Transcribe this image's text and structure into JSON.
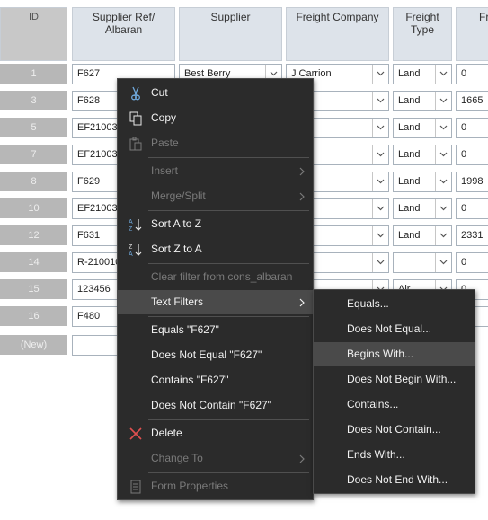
{
  "columns": {
    "id": "ID",
    "supplier_ref": "Supplier Ref/ Albaran",
    "supplier": "Supplier",
    "freight_company": "Freight Company",
    "freight_type": "Freight Type",
    "fr": "Fr"
  },
  "rows": [
    {
      "id": "1",
      "ref": "F627",
      "supplier": "Best Berry",
      "fc": "J Carrion",
      "ft": "Land",
      "fr": "0"
    },
    {
      "id": "3",
      "ref": "F628",
      "supplier": "",
      "fc": "",
      "ft": "Land",
      "fr": "1665"
    },
    {
      "id": "5",
      "ref": "EF210037",
      "supplier": "",
      "fc": "rrion",
      "ft": "Land",
      "fr": "0"
    },
    {
      "id": "7",
      "ref": "EF210037",
      "supplier": "",
      "fc": "rrion",
      "ft": "Land",
      "fr": "0"
    },
    {
      "id": "8",
      "ref": "F629",
      "supplier": "",
      "fc": "",
      "ft": "Land",
      "fr": "1998"
    },
    {
      "id": "10",
      "ref": "EF210037",
      "supplier": "",
      "fc": "rrion",
      "ft": "Land",
      "fr": "0"
    },
    {
      "id": "12",
      "ref": "F631",
      "supplier": "",
      "fc": "",
      "ft": "Land",
      "fr": "2331"
    },
    {
      "id": "14",
      "ref": "R-210010",
      "supplier": "",
      "fc": "",
      "ft": "",
      "fr": "0"
    },
    {
      "id": "15",
      "ref": "123456",
      "supplier": "",
      "fc": "",
      "ft": "Air",
      "fr": "0"
    },
    {
      "id": "16",
      "ref": "F480",
      "supplier": "",
      "fc": "",
      "ft": "",
      "fr": "0"
    }
  ],
  "new_row_label": "(New)",
  "context_menu": {
    "cut": "Cut",
    "copy": "Copy",
    "paste": "Paste",
    "insert": "Insert",
    "merge_split": "Merge/Split",
    "sort_az": "Sort A to Z",
    "sort_za": "Sort Z to A",
    "clear_filter": "Clear filter from cons_albaran",
    "text_filters": "Text Filters",
    "equals": "Equals \"F627\"",
    "not_equal": "Does Not Equal \"F627\"",
    "contains": "Contains \"F627\"",
    "not_contain": "Does Not Contain \"F627\"",
    "delete": "Delete",
    "change_to": "Change To",
    "form_properties": "Form Properties"
  },
  "submenu": {
    "equals": "Equals...",
    "not_equal": "Does Not Equal...",
    "begins_with": "Begins With...",
    "not_begin": "Does Not Begin With...",
    "contains": "Contains...",
    "not_contain": "Does Not Contain...",
    "ends_with": "Ends With...",
    "not_end": "Does Not End With..."
  },
  "colors": {
    "menu_bg": "#2b2b2b",
    "menu_highlight": "#4a4a4a",
    "delete_icon": "#e05050",
    "header_bg": "#dde3ea",
    "id_cell_bg": "#b7b7b7"
  }
}
